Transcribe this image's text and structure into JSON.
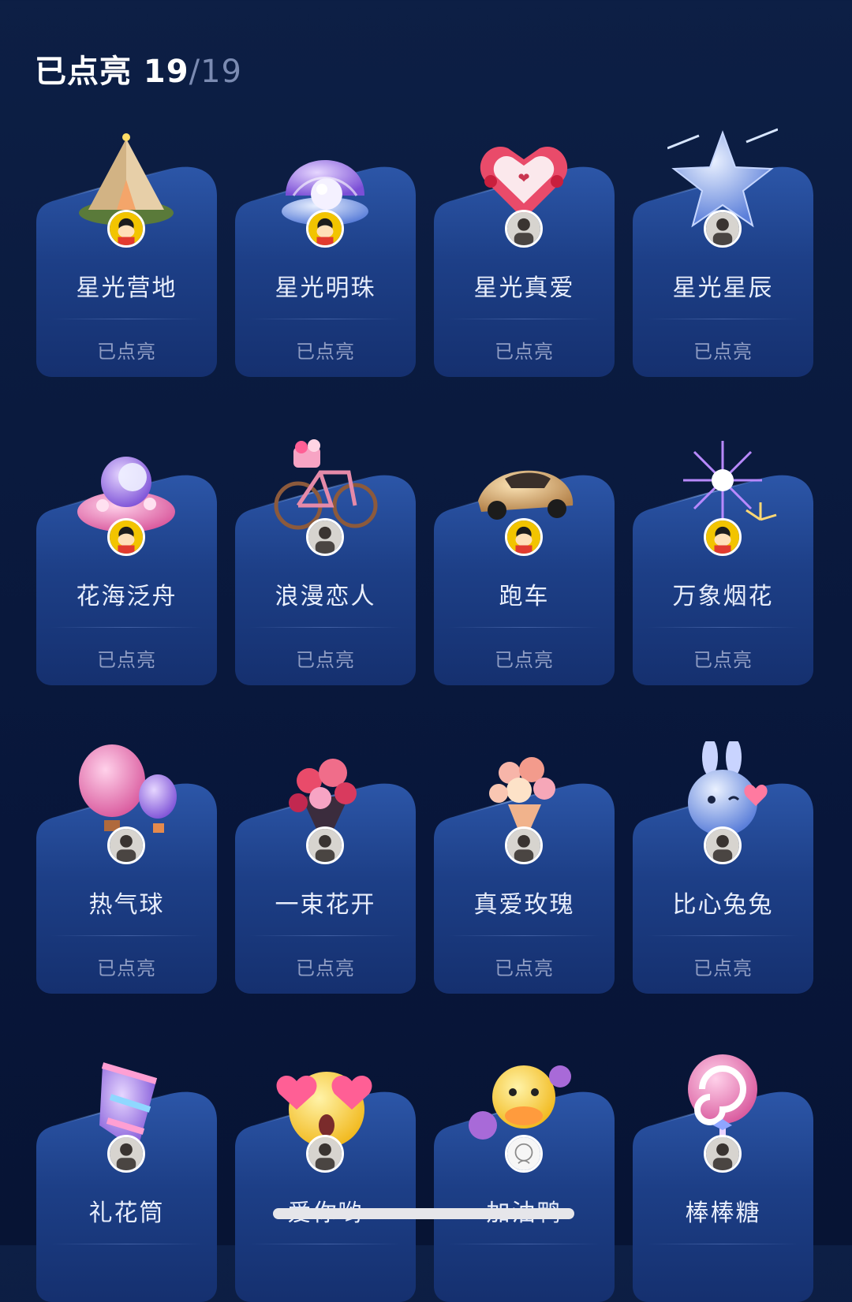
{
  "header": {
    "prefix": "已点亮 19",
    "total": "/19"
  },
  "colors": {
    "background": "#0a1a3e",
    "card_top": "#2c56a8",
    "card_bottom": "#15306f",
    "status_text": "#8f9dc4"
  },
  "cards": [
    {
      "title": "星光营地",
      "status": "已点亮",
      "icon": "tent-icon",
      "avatar": "cartoon-avatar"
    },
    {
      "title": "星光明珠",
      "status": "已点亮",
      "icon": "pearl-shell-icon",
      "avatar": "cartoon-avatar"
    },
    {
      "title": "星光真爱",
      "status": "已点亮",
      "icon": "heart-box-icon",
      "avatar": "photo-avatar"
    },
    {
      "title": "星光星辰",
      "status": "已点亮",
      "icon": "star-icon",
      "avatar": "photo-avatar"
    },
    {
      "title": "花海泛舟",
      "status": "已点亮",
      "icon": "flower-boat-icon",
      "avatar": "cartoon-avatar"
    },
    {
      "title": "浪漫恋人",
      "status": "已点亮",
      "icon": "bicycle-icon",
      "avatar": "photo-avatar"
    },
    {
      "title": "跑车",
      "status": "已点亮",
      "icon": "sports-car-icon",
      "avatar": "cartoon-avatar"
    },
    {
      "title": "万象烟花",
      "status": "已点亮",
      "icon": "fireworks-icon",
      "avatar": "cartoon-avatar"
    },
    {
      "title": "热气球",
      "status": "已点亮",
      "icon": "hot-air-balloon-icon",
      "avatar": "photo-avatar"
    },
    {
      "title": "一束花开",
      "status": "已点亮",
      "icon": "bouquet-icon",
      "avatar": "photo-avatar"
    },
    {
      "title": "真爱玫瑰",
      "status": "已点亮",
      "icon": "rose-bouquet-icon",
      "avatar": "photo-avatar"
    },
    {
      "title": "比心兔兔",
      "status": "已点亮",
      "icon": "bunny-icon",
      "avatar": "photo-avatar"
    },
    {
      "title": "礼花筒",
      "status": "",
      "icon": "party-popper-icon",
      "avatar": "photo-avatar"
    },
    {
      "title": "爱你哟",
      "status": "",
      "icon": "love-emoji-icon",
      "avatar": "photo-avatar"
    },
    {
      "title": "加油鸭",
      "status": "",
      "icon": "duck-icon",
      "avatar": "sketch-avatar"
    },
    {
      "title": "棒棒糖",
      "status": "",
      "icon": "lollipop-icon",
      "avatar": "photo-avatar"
    }
  ]
}
